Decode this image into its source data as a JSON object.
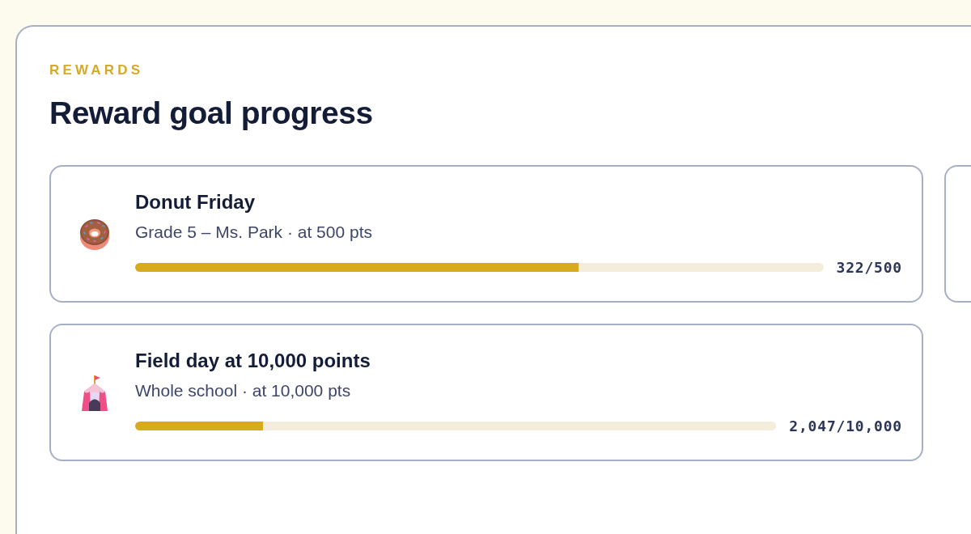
{
  "section": {
    "eyebrow": "REWARDS",
    "title": "Reward goal progress"
  },
  "goals": [
    {
      "kind": "snack",
      "title": "Donut Friday",
      "subtitle": "Grade 5 – Ms. Park · at 500 pts",
      "level": 0.644,
      "reading": "322/500"
    },
    {
      "kind": "clipped"
    },
    {
      "kind": "event",
      "title": "Field day at 10,000 points",
      "subtitle": "Whole school · at 10,000 pts",
      "level": 0.2,
      "reading": "2,047/10,000"
    }
  ]
}
